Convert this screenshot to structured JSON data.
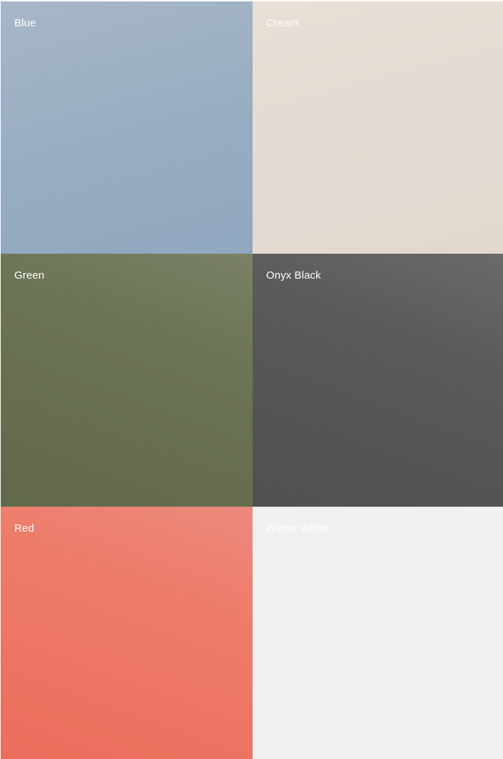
{
  "swatches": [
    {
      "label": "Blue",
      "color": "#9aaec3",
      "label_color": "#ffffff"
    },
    {
      "label": "Cream",
      "color": "#e3dbd3",
      "label_color": "#ffffff"
    },
    {
      "label": "Green",
      "color": "#6b7453",
      "label_color": "#ffffff"
    },
    {
      "label": "Onyx Black",
      "color": "#575757",
      "label_color": "#ffffff"
    },
    {
      "label": "Red",
      "color": "#ee7b69",
      "label_color": "#ffffff"
    },
    {
      "label": "Winter White",
      "color": "#f0f0f0",
      "label_color": "#ffffff"
    }
  ]
}
